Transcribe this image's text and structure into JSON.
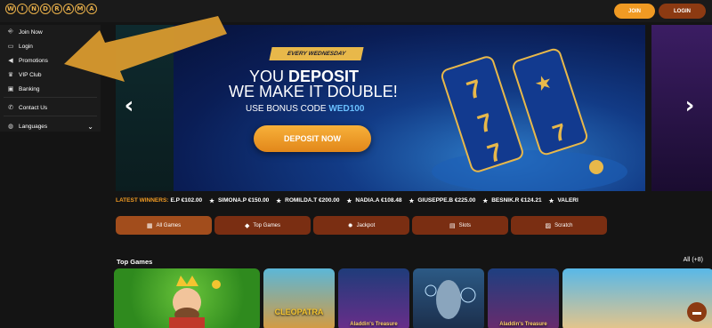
{
  "header": {
    "logo_letters": [
      "W",
      "I",
      "N",
      "D",
      "R",
      "A",
      "M",
      "A"
    ],
    "join_label": "JOIN",
    "login_label": "LOGIN"
  },
  "sidebar": {
    "items": [
      {
        "label": "Join Now",
        "icon": "join-icon"
      },
      {
        "label": "Login",
        "icon": "login-icon"
      },
      {
        "label": "Promotions",
        "icon": "megaphone-icon"
      },
      {
        "label": "VIP Club",
        "icon": "vip-icon"
      },
      {
        "label": "Banking",
        "icon": "banking-icon"
      },
      {
        "label": "Contact Us",
        "icon": "phone-icon"
      },
      {
        "label": "Languages",
        "icon": "globe-icon"
      }
    ]
  },
  "banner": {
    "badge": "EVERY WEDNESDAY",
    "line1_pre": "YOU ",
    "line1_bold": "DEPOSIT",
    "line2": "WE MAKE IT DOUBLE!",
    "line3_pre": "USE BONUS CODE ",
    "code": "WED100",
    "cta": "DEPOSIT NOW"
  },
  "ticker": {
    "label": "LATEST WINNERS:",
    "items": [
      "E.P €102.00",
      "SIMONA.P €150.00",
      "ROMILDA.T €200.00",
      "NADIA.A €108.48",
      "GIUSEPPE.B €225.00",
      "BESNIK.R €124.21",
      "VALERI"
    ]
  },
  "tabs": [
    {
      "label": "All Games",
      "icon": "grid-icon",
      "active": true
    },
    {
      "label": "Top Games",
      "icon": "diamond-icon"
    },
    {
      "label": "Jackpot",
      "icon": "coin-icon"
    },
    {
      "label": "Slots",
      "icon": "slots-icon"
    },
    {
      "label": "Scratch",
      "icon": "scratch-icon"
    }
  ],
  "top_games": {
    "title": "Top Games",
    "all_label": "All (+8)",
    "games": [
      {
        "caption": ""
      },
      {
        "caption": "CLEOPATRA"
      },
      {
        "caption": "Aladdin's Treasure"
      },
      {
        "caption": ""
      },
      {
        "caption": "Aladdin's Treasure"
      },
      {
        "caption": ""
      }
    ]
  },
  "colors": {
    "accent": "#f09a23",
    "brand_dark": "#8c3a12",
    "tab": "#7a2e12",
    "ticker_label": "#f09a23"
  }
}
